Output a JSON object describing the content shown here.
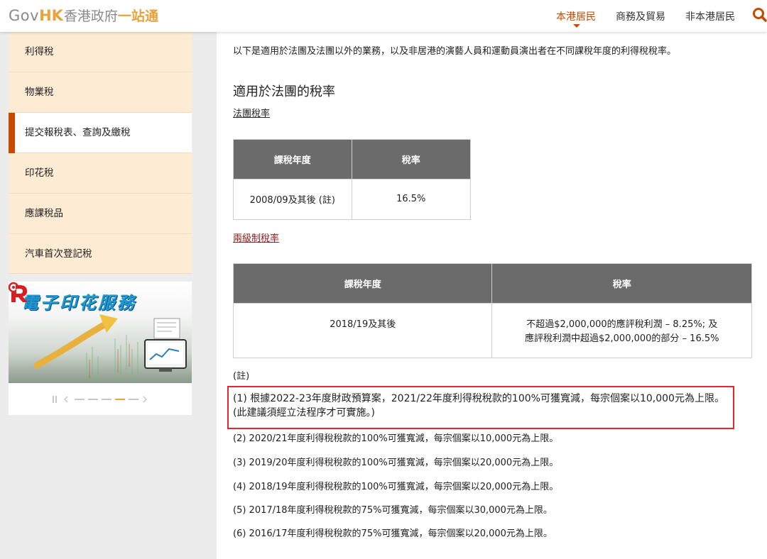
{
  "header": {
    "logo_gov": "Gov",
    "logo_hk": "HK",
    "logo_name": "香港政府",
    "logo_onestop": "一站通",
    "nav": [
      "本港居民",
      "商務及貿易",
      "非本港居民"
    ]
  },
  "sidebar": {
    "items": [
      {
        "label": "利得稅",
        "active": false
      },
      {
        "label": "物業稅",
        "active": false
      },
      {
        "label": "提交報稅表、查詢及繳稅",
        "active": true
      },
      {
        "label": "印花稅",
        "active": false
      },
      {
        "label": "應課稅品",
        "active": false
      },
      {
        "label": "汽車首次登記稅",
        "active": false
      }
    ],
    "promo_title": "電子印花服務",
    "carousel": {
      "slides": 5,
      "current": 4
    }
  },
  "main": {
    "intro": "以下是適用於法團及法團以外的業務，以及非居港的演藝人員和運動員演出者在不同課稅年度的利得稅稅率。",
    "section_title": "適用於法團的稅率",
    "link_corporate": "法團稅率",
    "table1": {
      "headers": [
        "課稅年度",
        "稅率"
      ],
      "row": [
        "2008/09及其後 (註)",
        "16.5%"
      ]
    },
    "link_two_tier": "兩級制稅率",
    "table2": {
      "headers": [
        "課稅年度",
        "稅率"
      ],
      "row_year": "2018/19及其後",
      "row_rate_line1": "不超過$2,000,000的應評稅利潤 – 8.25%; 及",
      "row_rate_line2": "應評稅利潤中超過$2,000,000的部分 – 16.5%"
    },
    "notes_label": "(註)",
    "notes": [
      "(1) 根據2022-23年度財政預算案，2021/22年度利得稅稅款的100%可獲寬減，每宗個案以10,000元為上限。 (此建議須經立法程序才可實施。)",
      "(2) 2020/21年度利得稅稅款的100%可獲寬減，每宗個案以10,000元為上限。",
      "(3) 2019/20年度利得稅稅款的100%可獲寬減，每宗個案以20,000元為上限。",
      "(4) 2018/19年度利得稅稅款的100%可獲寬減，每宗個案以20,000元為上限。",
      "(5) 2017/18年度利得稅稅款的75%可獲寬減，每宗個案以30,000元為上限。",
      "(6) 2016/17年度利得稅稅款的75%可獲寬減，每宗個案以20,000元為上限。"
    ]
  },
  "colors": {
    "accent": "#c84a00",
    "logo_orange": "#e8a33c",
    "sidebar_item_bg": "#fdebd3",
    "table_header_bg": "#6b6b6b",
    "highlight_border": "#e8262e"
  }
}
